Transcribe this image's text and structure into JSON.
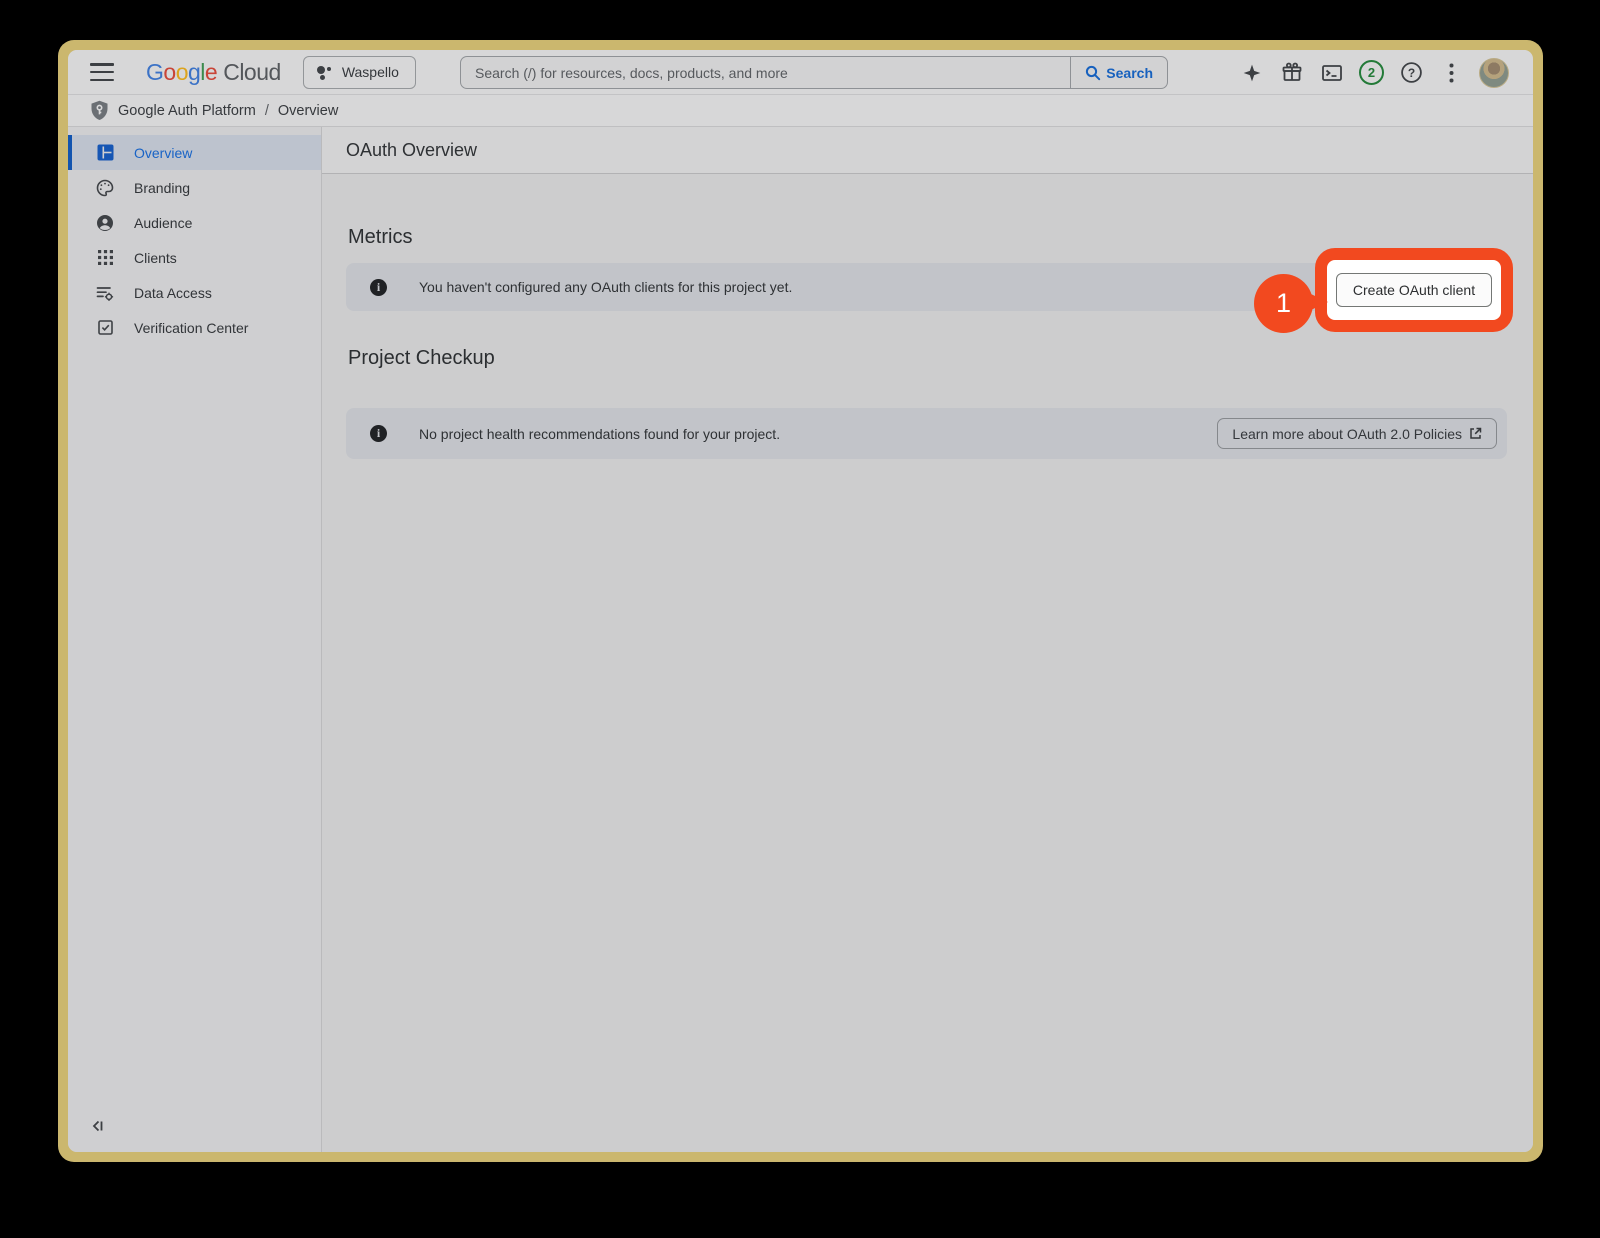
{
  "topbar": {
    "logo": {
      "letters": [
        {
          "char": "G"
        },
        {
          "char": "o"
        },
        {
          "char": "o"
        },
        {
          "char": "g"
        },
        {
          "char": "l"
        },
        {
          "char": "e"
        }
      ],
      "cloud": "Cloud"
    },
    "project_selector": {
      "label": "Waspello"
    },
    "search": {
      "placeholder": "Search (/) for resources, docs, products, and more",
      "button_label": "Search"
    },
    "notifications_count": "2",
    "icons": [
      "gemini-sparkle-icon",
      "gift-icon",
      "cloud-shell-icon",
      "notifications-badge",
      "help-icon",
      "more-vertical-icon",
      "avatar"
    ]
  },
  "breadcrumb": {
    "section": "Google Auth Platform",
    "separator": "/",
    "page": "Overview"
  },
  "sidebar": {
    "items": [
      {
        "label": "Overview",
        "icon": "dashboard-icon",
        "active": true
      },
      {
        "label": "Branding",
        "icon": "palette-icon",
        "active": false
      },
      {
        "label": "Audience",
        "icon": "account-icon",
        "active": false
      },
      {
        "label": "Clients",
        "icon": "apps-grid-icon",
        "active": false
      },
      {
        "label": "Data Access",
        "icon": "data-access-gear-icon",
        "active": false
      },
      {
        "label": "Verification Center",
        "icon": "verification-check-icon",
        "active": false
      }
    ]
  },
  "content": {
    "page_title": "OAuth Overview",
    "metrics": {
      "heading": "Metrics",
      "message": "You haven't configured any OAuth clients for this project yet.",
      "create_button_label": "Create OAuth client"
    },
    "project_checkup": {
      "heading": "Project Checkup",
      "message": "No project health recommendations found for your project.",
      "learn_more_label": "Learn more about OAuth 2.0 Policies"
    }
  },
  "annotation": {
    "step_number": "1",
    "color": "#F2491F"
  },
  "colors": {
    "annotation_red": "#F2491F",
    "active_blue": "#1863C6",
    "badge_green": "#237A38",
    "frame_tan": "#CBB76E",
    "infobar_gray": "#C2C4C9"
  }
}
